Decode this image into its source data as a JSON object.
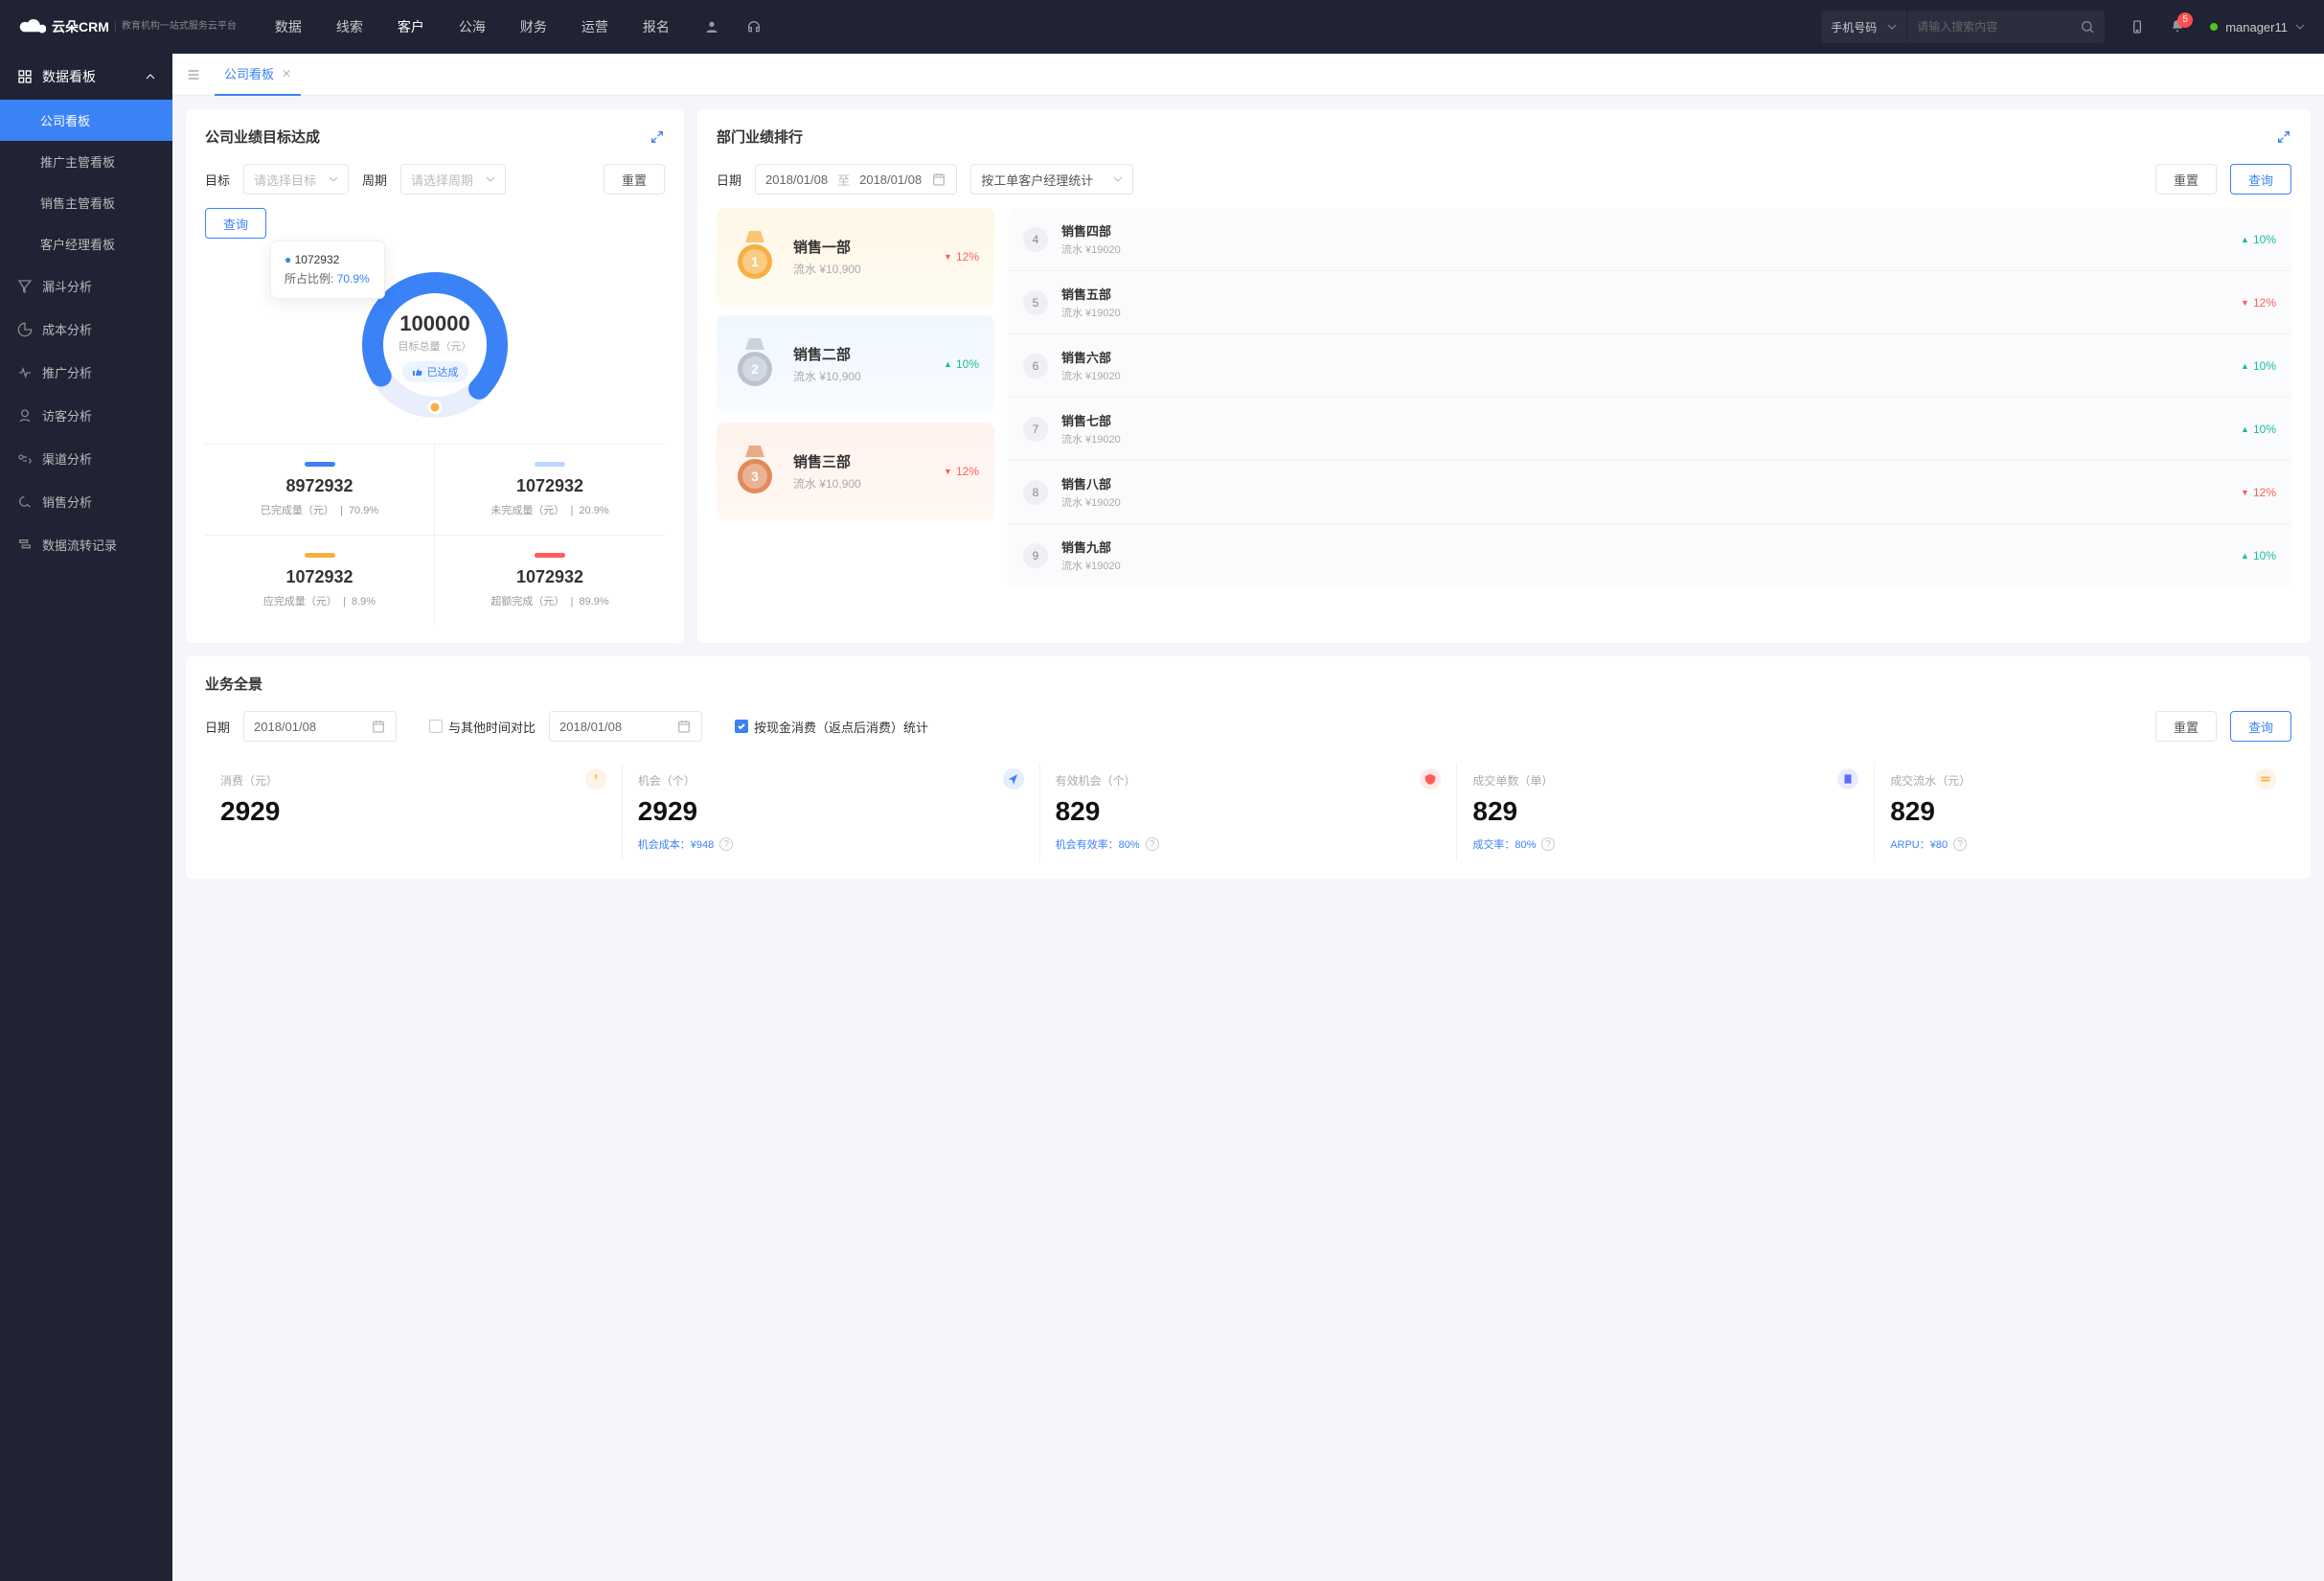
{
  "header": {
    "brand": "云朵CRM",
    "brand_sub": "教育机构一站式服务云平台",
    "nav": [
      "数据",
      "线索",
      "客户",
      "公海",
      "财务",
      "运营",
      "报名"
    ],
    "nav_active": 2,
    "search_type": "手机号码",
    "search_placeholder": "请输入搜索内容",
    "badge": "5",
    "username": "manager11"
  },
  "sidebar": {
    "group_title": "数据看板",
    "children": [
      "公司看板",
      "推广主管看板",
      "销售主管看板",
      "客户经理看板"
    ],
    "active_child": 0,
    "nodes": [
      "漏斗分析",
      "成本分析",
      "推广分析",
      "访客分析",
      "渠道分析",
      "销售分析",
      "数据流转记录"
    ]
  },
  "tabs": {
    "active_label": "公司看板"
  },
  "card_goal": {
    "title": "公司业绩目标达成",
    "filters": {
      "goal_label": "目标",
      "goal_placeholder": "请选择目标",
      "period_label": "周期",
      "period_placeholder": "请选择周期",
      "reset": "重置",
      "query": "查询"
    },
    "tooltip": {
      "value": "1072932",
      "ratio_label": "所占比例:",
      "ratio": "70.9%"
    },
    "center": {
      "num": "100000",
      "sub": "目标总量（元）",
      "badge": "已达成"
    },
    "stats": [
      {
        "color": "#3b82f6",
        "value": "8972932",
        "label": "已完成量（元）",
        "pct": "70.9%"
      },
      {
        "color": "#bcd7ff",
        "value": "1072932",
        "label": "未完成量（元）",
        "pct": "20.9%"
      },
      {
        "color": "#f6b042",
        "value": "1072932",
        "label": "应完成量（元）",
        "pct": "8.9%"
      },
      {
        "color": "#ff5c5c",
        "value": "1072932",
        "label": "超额完成（元）",
        "pct": "89.9%"
      }
    ]
  },
  "card_rank": {
    "title": "部门业绩排行",
    "filters": {
      "date_label": "日期",
      "date_from": "2018/01/08",
      "date_to_label": "至",
      "date_to": "2018/01/08",
      "stat_by": "按工单客户经理统计",
      "reset": "重置",
      "query": "查询"
    },
    "top3": [
      {
        "name": "销售一部",
        "flow": "流水 ¥10,900",
        "pct": "12%",
        "dir": "down"
      },
      {
        "name": "销售二部",
        "flow": "流水 ¥10,900",
        "pct": "10%",
        "dir": "up"
      },
      {
        "name": "销售三部",
        "flow": "流水 ¥10,900",
        "pct": "12%",
        "dir": "down"
      }
    ],
    "rest": [
      {
        "idx": "4",
        "name": "销售四部",
        "flow": "流水 ¥19020",
        "pct": "10%",
        "dir": "up"
      },
      {
        "idx": "5",
        "name": "销售五部",
        "flow": "流水 ¥19020",
        "pct": "12%",
        "dir": "down"
      },
      {
        "idx": "6",
        "name": "销售六部",
        "flow": "流水 ¥19020",
        "pct": "10%",
        "dir": "up"
      },
      {
        "idx": "7",
        "name": "销售七部",
        "flow": "流水 ¥19020",
        "pct": "10%",
        "dir": "up"
      },
      {
        "idx": "8",
        "name": "销售八部",
        "flow": "流水 ¥19020",
        "pct": "12%",
        "dir": "down"
      },
      {
        "idx": "9",
        "name": "销售九部",
        "flow": "流水 ¥19020",
        "pct": "10%",
        "dir": "up"
      }
    ]
  },
  "card_biz": {
    "title": "业务全景",
    "filters": {
      "date_label": "日期",
      "date1": "2018/01/08",
      "compare_label": "与其他时间对比",
      "date2": "2018/01/08",
      "check_label": "按现金消费（返点后消费）统计",
      "reset": "重置",
      "query": "查询"
    },
    "cells": [
      {
        "label": "消费（元）",
        "value": "2929",
        "sub": "",
        "icon": "#f6b042"
      },
      {
        "label": "机会（个）",
        "value": "2929",
        "sub": "机会成本：¥948",
        "icon": "#3b82f6"
      },
      {
        "label": "有效机会（个）",
        "value": "829",
        "sub": "机会有效率：80%",
        "icon": "#ff5c5c"
      },
      {
        "label": "成交单数（单）",
        "value": "829",
        "sub": "成交率：80%",
        "icon": "#5b6bff"
      },
      {
        "label": "成交流水（元）",
        "value": "829",
        "sub": "ARPU：¥80",
        "icon": "#f6b042"
      }
    ]
  },
  "chart_data": {
    "type": "pie",
    "title": "公司业绩目标达成",
    "total_label": "目标总量（元）",
    "total": 100000,
    "series": [
      {
        "name": "已完成量（元）",
        "value": 8972932,
        "percent": 70.9,
        "color": "#3b82f6"
      },
      {
        "name": "未完成量（元）",
        "value": 1072932,
        "percent": 20.9,
        "color": "#bcd7ff"
      },
      {
        "name": "应完成量（元）",
        "value": 1072932,
        "percent": 8.9,
        "color": "#f6b042"
      },
      {
        "name": "超额完成（元）",
        "value": 1072932,
        "percent": 89.9,
        "color": "#ff5c5c"
      }
    ]
  }
}
